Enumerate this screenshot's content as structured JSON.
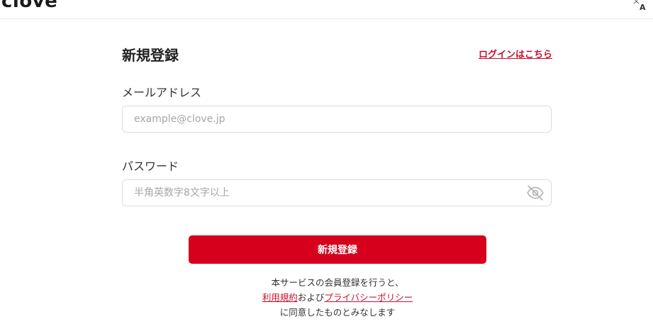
{
  "header": {
    "logo_text": "clove",
    "language_icon": "translate-icon"
  },
  "form": {
    "title": "新規登録",
    "login_link": "ログインはこちら",
    "email": {
      "label": "メールアドレス",
      "placeholder": "example@clove.jp",
      "value": ""
    },
    "password": {
      "label": "パスワード",
      "placeholder": "半角英数字8文字以上",
      "value": "",
      "toggle_icon": "eye-off-icon"
    },
    "submit_label": "新規登録"
  },
  "notice": {
    "line1": "本サービスの会員登録を行うと、",
    "terms_link": "利用規約",
    "joiner": "および",
    "privacy_link": "プライバシーポリシー",
    "line3": "に同意したものとみなします"
  },
  "colors": {
    "accent": "#d6001c",
    "link": "#c8102e",
    "border": "#dcdcdc",
    "placeholder": "#a6a6a6"
  }
}
